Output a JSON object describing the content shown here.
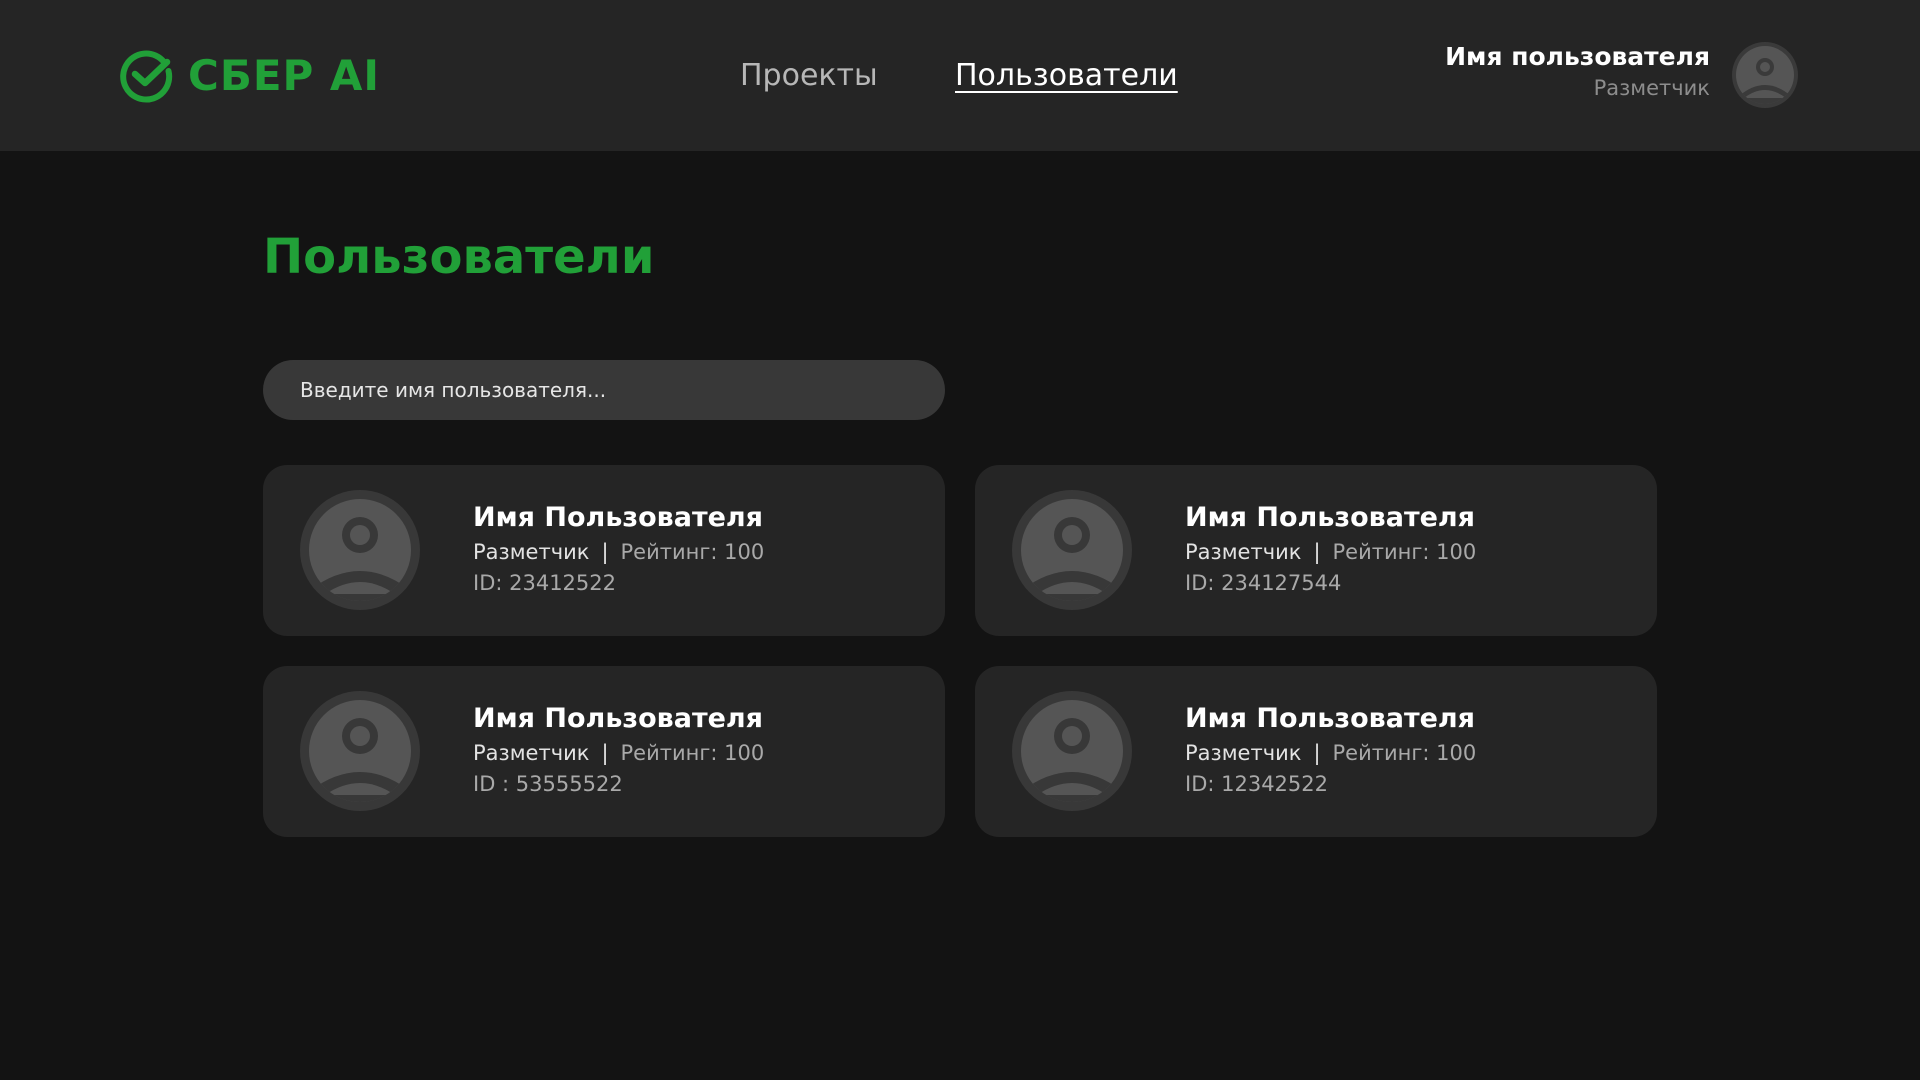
{
  "header": {
    "logo_text": "СБЕР AI",
    "logo_icon": "sber-check-circle-icon",
    "brand_color": "#21a038",
    "nav": [
      {
        "label": "Проекты",
        "active": false
      },
      {
        "label": "Пользователи",
        "active": true
      }
    ],
    "current_user": {
      "name": "Имя пользователя",
      "role": "Разметчик",
      "avatar_icon": "user-avatar-icon"
    }
  },
  "main": {
    "title": "Пользователи",
    "search": {
      "placeholder": "Введите имя пользователя...",
      "value": ""
    },
    "users": [
      {
        "name": "Имя Пользователя",
        "role": "Разметчик",
        "separator": "|",
        "rating": "Рейтинг: 100",
        "id": "ID: 23412522"
      },
      {
        "name": "Имя Пользователя",
        "role": "Разметчик",
        "separator": "|",
        "rating": "Рейтинг: 100",
        "id": "ID: 234127544"
      },
      {
        "name": "Имя Пользователя",
        "role": "Разметчик",
        "separator": "|",
        "rating": "Рейтинг: 100",
        "id": "ID : 53555522"
      },
      {
        "name": "Имя Пользователя",
        "role": "Разметчик",
        "separator": "|",
        "rating": "Рейтинг: 100",
        "id": "ID: 12342522"
      }
    ]
  },
  "colors": {
    "background": "#131313",
    "header_bg": "#252525",
    "card_bg": "#252525",
    "search_bg": "#383838",
    "accent": "#21a038"
  }
}
